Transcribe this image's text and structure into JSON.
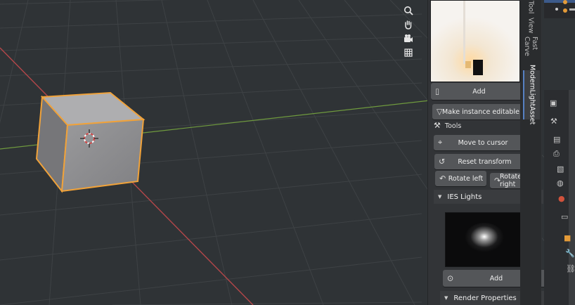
{
  "viewport": {
    "nav_icons": [
      "zoom-icon",
      "hand-pan-icon",
      "camera-icon",
      "grid-icon"
    ]
  },
  "npanel": {
    "tabs": [
      "Tool",
      "View",
      "Fast Carve",
      "ModernLightAsset"
    ],
    "add_label": "Add",
    "make_instance_label": "Make instance editable",
    "tools_label": "Tools",
    "move_to_cursor_label": "Move to cursor",
    "reset_transform_label": "Reset transform",
    "rotate_left_label": "Rotate left",
    "rotate_right_label": "Rotate right",
    "ies_header": "IES Lights",
    "ies_add_label": "Add",
    "render_header": "Render Properties"
  },
  "colors": {
    "accent": "#5680c2",
    "selection_outline": "#f0a23a",
    "x_axis": "#b4474a",
    "y_axis": "#6f9a3e"
  }
}
